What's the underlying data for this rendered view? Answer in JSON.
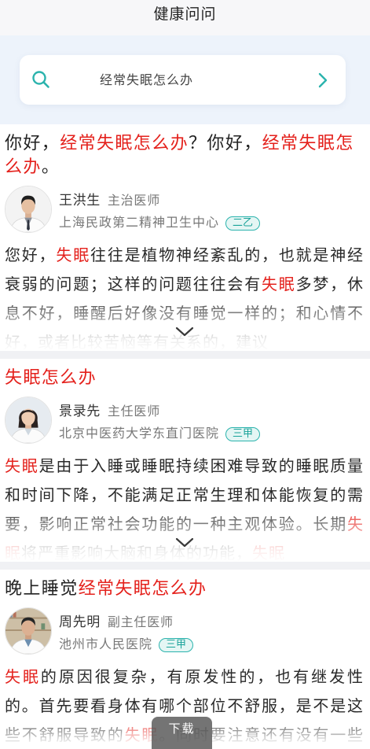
{
  "header": {
    "title": "健康问问"
  },
  "search": {
    "query": "经常失眠怎么办",
    "icon": "search-icon",
    "submit_icon": "chevron-right-icon"
  },
  "colors": {
    "keyword": "#e4211c",
    "accent": "#2bb3ad",
    "accent_text": "#1aa39a"
  },
  "cards": [
    {
      "title": [
        {
          "t": "你好，"
        },
        {
          "t": "经常失眠怎么办",
          "keyword": true
        },
        {
          "t": "？你好，"
        },
        {
          "t": "经常失眠怎么办",
          "keyword": true
        },
        {
          "t": "。"
        }
      ],
      "doctor": {
        "name": "王洪生",
        "title": "主治医师",
        "hospital": "上海民政第二精神卫生中心",
        "level": "二乙"
      },
      "excerpt": [
        [
          {
            "t": "您好，"
          },
          {
            "t": "失眠",
            "keyword": true
          },
          {
            "t": "往往是植物神经紊乱的，也就是神经"
          }
        ],
        [
          {
            "t": "衰弱的问题；这样的问题往往会有"
          },
          {
            "t": "失眠",
            "keyword": true
          },
          {
            "t": "多梦，休"
          }
        ],
        [
          {
            "t": "息不好，睡醒后好像没有睡觉一样的；和心情不"
          }
        ],
        [
          {
            "t": "好，或者比较苦恼等有关系的，建议"
          }
        ]
      ],
      "expand_icon": "chevron-down-icon"
    },
    {
      "title": [
        {
          "t": "失眠怎么办",
          "keyword": true
        }
      ],
      "doctor": {
        "name": "景录先",
        "title": "主任医师",
        "hospital": "北京中医药大学东直门医院",
        "level": "三甲"
      },
      "excerpt": [
        [
          {
            "t": "失眠",
            "keyword": true
          },
          {
            "t": "是由于入睡或睡眠持续困难导致的睡眠质量"
          }
        ],
        [
          {
            "t": "和时间下降，不能满足正常生理和体能恢复的需"
          }
        ],
        [
          {
            "t": "要，影响正常社会功能的一种主观体验。长期"
          },
          {
            "t": "失",
            "keyword": true
          }
        ],
        [
          {
            "t": "眠",
            "keyword": true
          },
          {
            "t": "将严重影响大脑和身体的功能，"
          },
          {
            "t": "失眠",
            "keyword": true
          }
        ]
      ],
      "expand_icon": "chevron-down-icon"
    },
    {
      "title": [
        {
          "t": "晚上睡觉"
        },
        {
          "t": "经常失眠怎么办",
          "keyword": true
        }
      ],
      "doctor": {
        "name": "周先明",
        "title": "副主任医师",
        "hospital": "池州市人民医院",
        "level": "三甲"
      },
      "excerpt": [
        [
          {
            "t": "失眠",
            "keyword": true
          },
          {
            "t": "的原因很复杂，有原发性的，也有继发性"
          }
        ],
        [
          {
            "t": "的。首先要看身体有哪个部位不舒服，是不是这"
          }
        ],
        [
          {
            "t": "些不舒服导致的"
          },
          {
            "t": "失眠",
            "keyword": true
          },
          {
            "t": "。同时要注意还有没有一些"
          }
        ]
      ]
    }
  ],
  "download": {
    "label": "下载"
  }
}
